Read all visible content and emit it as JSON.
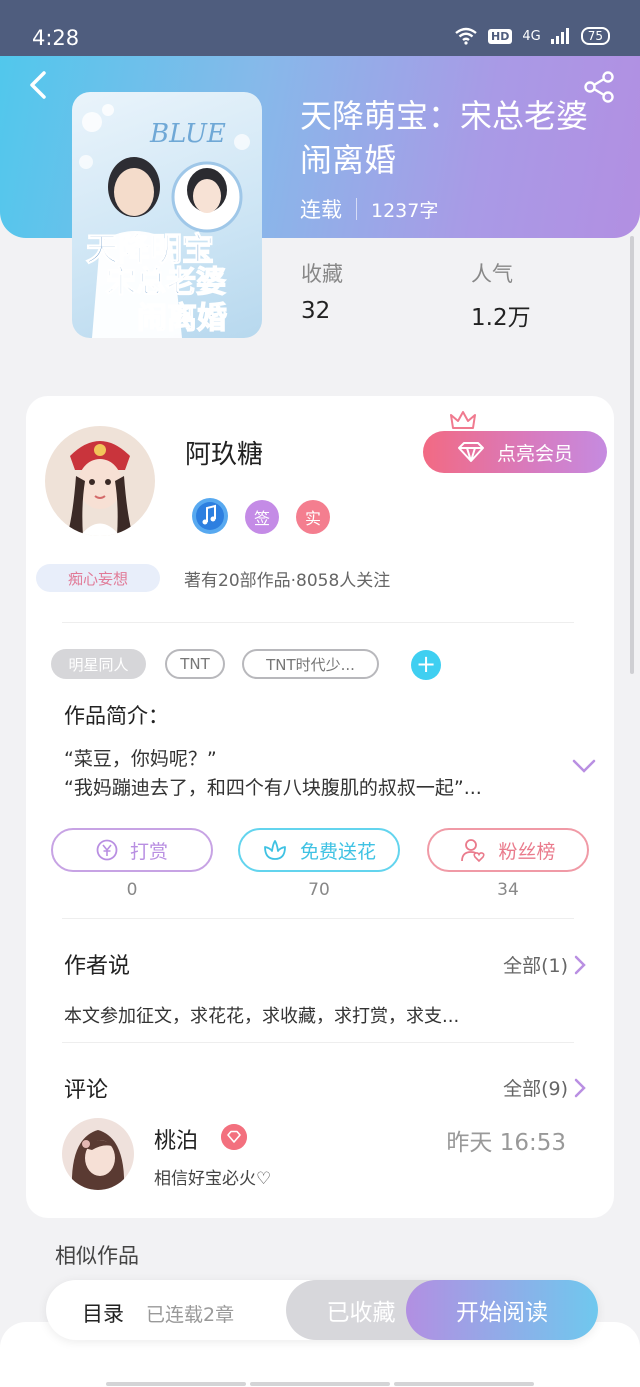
{
  "status_bar": {
    "time": "4:28",
    "network": "4G",
    "hd": "HD",
    "battery": "75"
  },
  "book": {
    "title": "天降萌宝：宋总老婆闹离婚",
    "status": "连载",
    "word_count": "1237字",
    "stats": [
      {
        "label": "收藏",
        "value": "32"
      },
      {
        "label": "人气",
        "value": "1.2万"
      }
    ]
  },
  "cover": {
    "title_lines": [
      "天降明宝",
      "宋总老婆",
      "闹离婚"
    ],
    "deco": "BLUE"
  },
  "author": {
    "name": "阿玖糖",
    "vip_button": "点亮会员",
    "badges": {
      "sign": "签",
      "real": "实"
    },
    "tag": "痴心妄想",
    "meta": "著有20部作品·8058人关注"
  },
  "tags": [
    "明星同人",
    "TNT",
    "TNT时代少..."
  ],
  "intro": {
    "title": "作品简介：",
    "lines": [
      "“菜豆，你妈呢？”",
      "“我妈蹦迪去了，和四个有八块腹肌的叔叔一起”..."
    ]
  },
  "actions": [
    {
      "label": "打赏",
      "count": "0"
    },
    {
      "label": "免费送花",
      "count": "70"
    },
    {
      "label": "粉丝榜",
      "count": "34"
    }
  ],
  "author_say": {
    "title": "作者说",
    "link": "全部(1)",
    "text": "本文参加征文，求花花，求收藏，求打赏，求支..."
  },
  "comments": {
    "title": "评论",
    "link": "全部(9)",
    "items": [
      {
        "name": "桃泊",
        "time": "昨天 16:53",
        "text": "相信好宝必火♡"
      }
    ]
  },
  "similar": {
    "title": "相似作品"
  },
  "bottom_bar": {
    "toc": "目录",
    "toc_status": "已连载2章",
    "saved": "已收藏",
    "read": "开始阅读"
  },
  "colors": {
    "header_start": "#4fc8ec",
    "header_end": "#b28fe2",
    "vip_pink": "#f26a83",
    "accent_blue": "#3fcff1",
    "accent_purple": "#b98fe2"
  },
  "icons": {
    "back": "back-arrow-icon",
    "share": "share-icon",
    "crown": "crown-icon",
    "diamond": "diamond-icon",
    "music_badge": "music-note-icon",
    "yen": "yen-icon",
    "flower": "flower-icon",
    "fans": "user-heart-icon",
    "chevron": "chevron-right-icon",
    "expand": "chevron-down-icon"
  }
}
